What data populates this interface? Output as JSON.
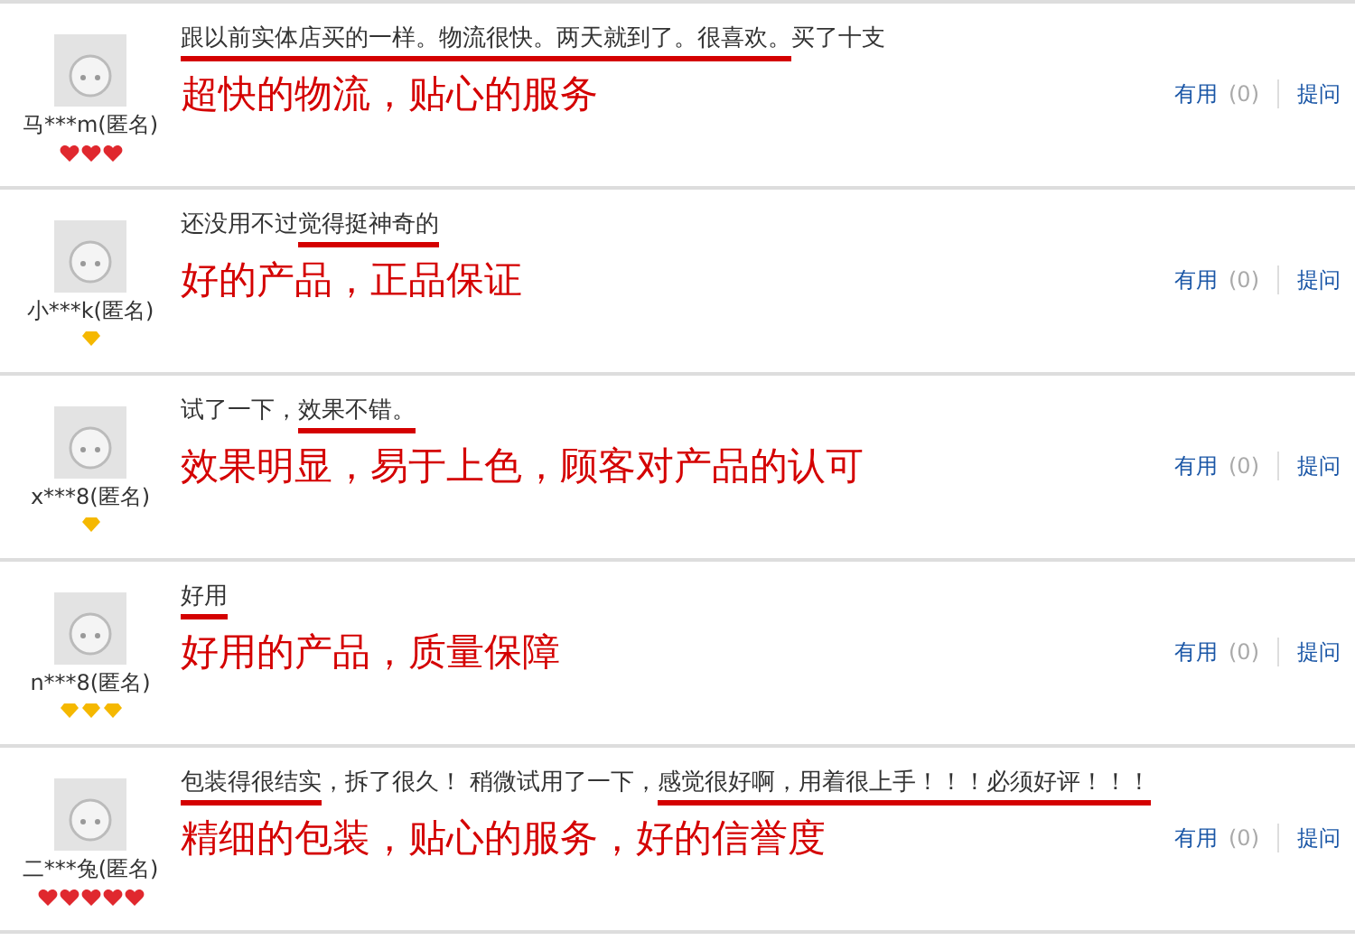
{
  "reviews": [
    {
      "user": "马***m(匿名)",
      "badges": [
        {
          "kind": "heart"
        },
        {
          "kind": "heart"
        },
        {
          "kind": "heart"
        }
      ],
      "comment": [
        {
          "text": "跟以前实体店买的一样。物流很快。两天就到了。很喜欢。",
          "underlined": true
        },
        {
          "text": "买了十支",
          "underlined": false
        }
      ],
      "annotation": "超快的物流，贴心的服务",
      "useful_label": "有用",
      "useful_count": "(0)",
      "ask_label": "提问"
    },
    {
      "user": "小***k(匿名)",
      "badges": [
        {
          "kind": "diamond"
        }
      ],
      "comment": [
        {
          "text": "还没用不过",
          "underlined": false
        },
        {
          "text": "觉得挺神奇的",
          "underlined": true
        }
      ],
      "annotation": "好的产品，正品保证",
      "useful_label": "有用",
      "useful_count": "(0)",
      "ask_label": "提问"
    },
    {
      "user": "x***8(匿名)",
      "badges": [
        {
          "kind": "diamond"
        }
      ],
      "comment": [
        {
          "text": "试了一下，",
          "underlined": false
        },
        {
          "text": "效果不错。",
          "underlined": true
        }
      ],
      "annotation": "效果明显，易于上色，顾客对产品的认可",
      "useful_label": "有用",
      "useful_count": "(0)",
      "ask_label": "提问"
    },
    {
      "user": "n***8(匿名)",
      "badges": [
        {
          "kind": "diamond"
        },
        {
          "kind": "diamond"
        },
        {
          "kind": "diamond"
        }
      ],
      "comment": [
        {
          "text": "好用",
          "underlined": true
        }
      ],
      "annotation": "好用的产品，质量保障",
      "useful_label": "有用",
      "useful_count": "(0)",
      "ask_label": "提问"
    },
    {
      "user": "二***兔(匿名)",
      "badges": [
        {
          "kind": "heart"
        },
        {
          "kind": "heart"
        },
        {
          "kind": "heart"
        },
        {
          "kind": "heart"
        },
        {
          "kind": "heart"
        }
      ],
      "comment": [
        {
          "text": "包装得很结实",
          "underlined": true
        },
        {
          "text": "，拆了很久！ 稍微试用了一下，",
          "underlined": false
        },
        {
          "text": "感觉很好啊，用着很上手！！！必须好评！！！",
          "underlined": true
        }
      ],
      "annotation": "精细的包装，贴心的服务，好的信誉度",
      "useful_label": "有用",
      "useful_count": "(0)",
      "ask_label": "提问"
    }
  ]
}
